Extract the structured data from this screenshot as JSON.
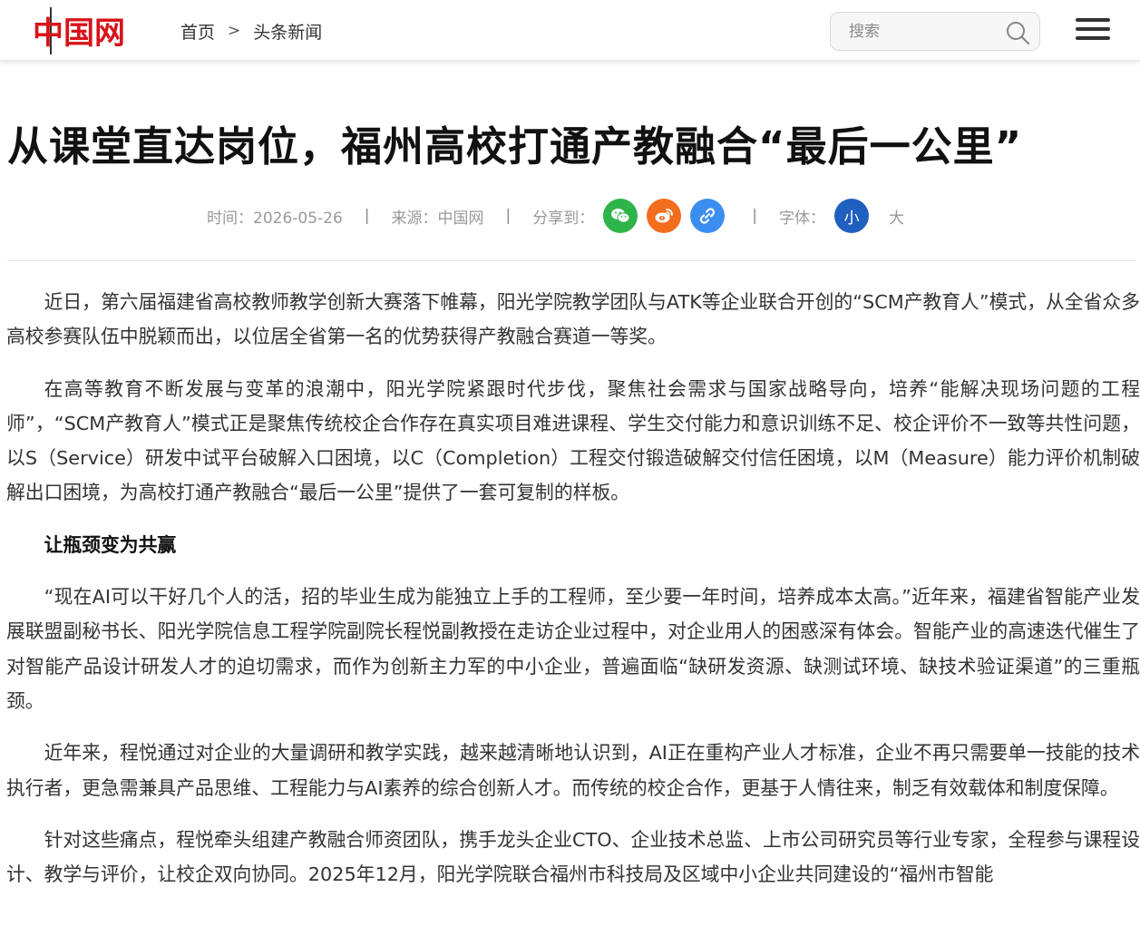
{
  "header": {
    "logo_text": "中国网",
    "breadcrumb": {
      "home": "首页",
      "separator": ">",
      "current": "头条新闻"
    },
    "search": {
      "placeholder": "搜索"
    }
  },
  "article": {
    "title": "从课堂直达岗位，福州高校打通产教融合“最后一公里”",
    "meta": {
      "time": "时间：2026-05-26",
      "source": "来源：中国网",
      "share_label": "分享到：",
      "font_label": "字体：",
      "font_small": "小",
      "font_large": "大",
      "divider": "|"
    },
    "paragraphs": [
      "近日，第六届福建省高校教师教学创新大赛落下帷幕，阳光学院教学团队与ATK等企业联合开创的“SCM产教育人”模式，从全省众多高校参赛队伍中脱颖而出，以位居全省第一名的优势获得产教融合赛道一等奖。",
      "在高等教育不断发展与变革的浪潮中，阳光学院紧跟时代步伐，聚焦社会需求与国家战略导向，培养“能解决现场问题的工程师”，“SCM产教育人”模式正是聚焦传统校企合作存在真实项目难进课程、学生交付能力和意识训练不足、校企评价不一致等共性问题，以S（Service）研发中试平台破解入口困境，以C（Completion）工程交付锻造破解交付信任困境，以M（Measure）能力评价机制破解出口困境，为高校打通产教融合“最后一公里”提供了一套可复制的样板。",
      "让瓶颈变为共赢",
      "“现在AI可以干好几个人的活，招的毕业生成为能独立上手的工程师，至少要一年时间，培养成本太高。”近年来，福建省智能产业发展联盟副秘书长、阳光学院信息工程学院副院长程悦副教授在走访企业过程中，对企业用人的困惑深有体会。智能产业的高速迭代催生了对智能产品设计研发人才的迫切需求，而作为创新主力军的中小企业，普遍面临“缺研发资源、缺测试环境、缺技术验证渠道”的三重瓶颈。",
      "近年来，程悦通过对企业的大量调研和教学实践，越来越清晰地认识到，AI正在重构产业人才标准，企业不再只需要单一技能的技术执行者，更急需兼具产品思维、工程能力与AI素养的综合创新人才。而传统的校企合作，更基于人情往来，制乏有效载体和制度保障。",
      "针对这些痛点，程悦牵头组建产教融合师资团队，携手龙头企业CTO、企业技术总监、上市公司研究员等行业专家，全程参与课程设计、教学与评价，让校企双向协同。2025年12月，阳光学院联合福州市科技局及区域中小企业共同建设的“福州市智能"
    ]
  },
  "colors": {
    "logo_red": "#d7141a",
    "logo_blue": "#1f5fbf",
    "wechat": "#2fb44a",
    "weibo": "#f36d1f",
    "link": "#3b8ef0",
    "font_active": "#1f5fbf"
  },
  "icons": {
    "search": "search-icon",
    "menu": "hamburger-menu-icon",
    "wechat": "wechat-icon",
    "weibo": "weibo-icon",
    "link": "link-icon"
  }
}
